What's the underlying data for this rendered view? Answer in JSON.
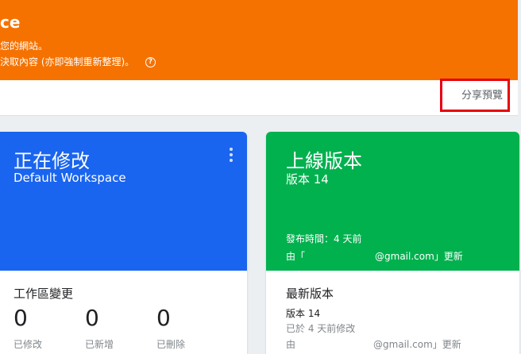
{
  "banner": {
    "title_fragment": "ce",
    "line1": "您的網站。",
    "line2": "決取內容 (亦即強制重新整理)。",
    "help_icon": "help-circle-icon"
  },
  "preview_bar": {
    "share_preview_label": "分享預覽",
    "highlight_color": "#e8000f"
  },
  "workspace_card": {
    "title": "正在修改",
    "subtitle": "Default Workspace",
    "menu_icon": "more-vertical-icon",
    "changes_title": "工作區變更",
    "counts": [
      {
        "value": "0",
        "label": "已修改"
      },
      {
        "value": "0",
        "label": "已新增"
      },
      {
        "value": "0",
        "label": "已刪除"
      }
    ],
    "color": "#1a65ef"
  },
  "live_card": {
    "title": "上線版本",
    "version": "版本 14",
    "published": "發布時間：4 天前",
    "published_by_prefix": "由「",
    "published_by_suffix": "@gmail.com」更新",
    "latest_title": "最新版本",
    "latest_version": "版本 14",
    "latest_modified": "已於 4 天前修改",
    "latest_by_prefix": "由",
    "latest_by_suffix": "@gmail.com」更新",
    "color": "#00b14e"
  },
  "theme": {
    "banner_color": "#f57200",
    "background": "#eceff1"
  }
}
